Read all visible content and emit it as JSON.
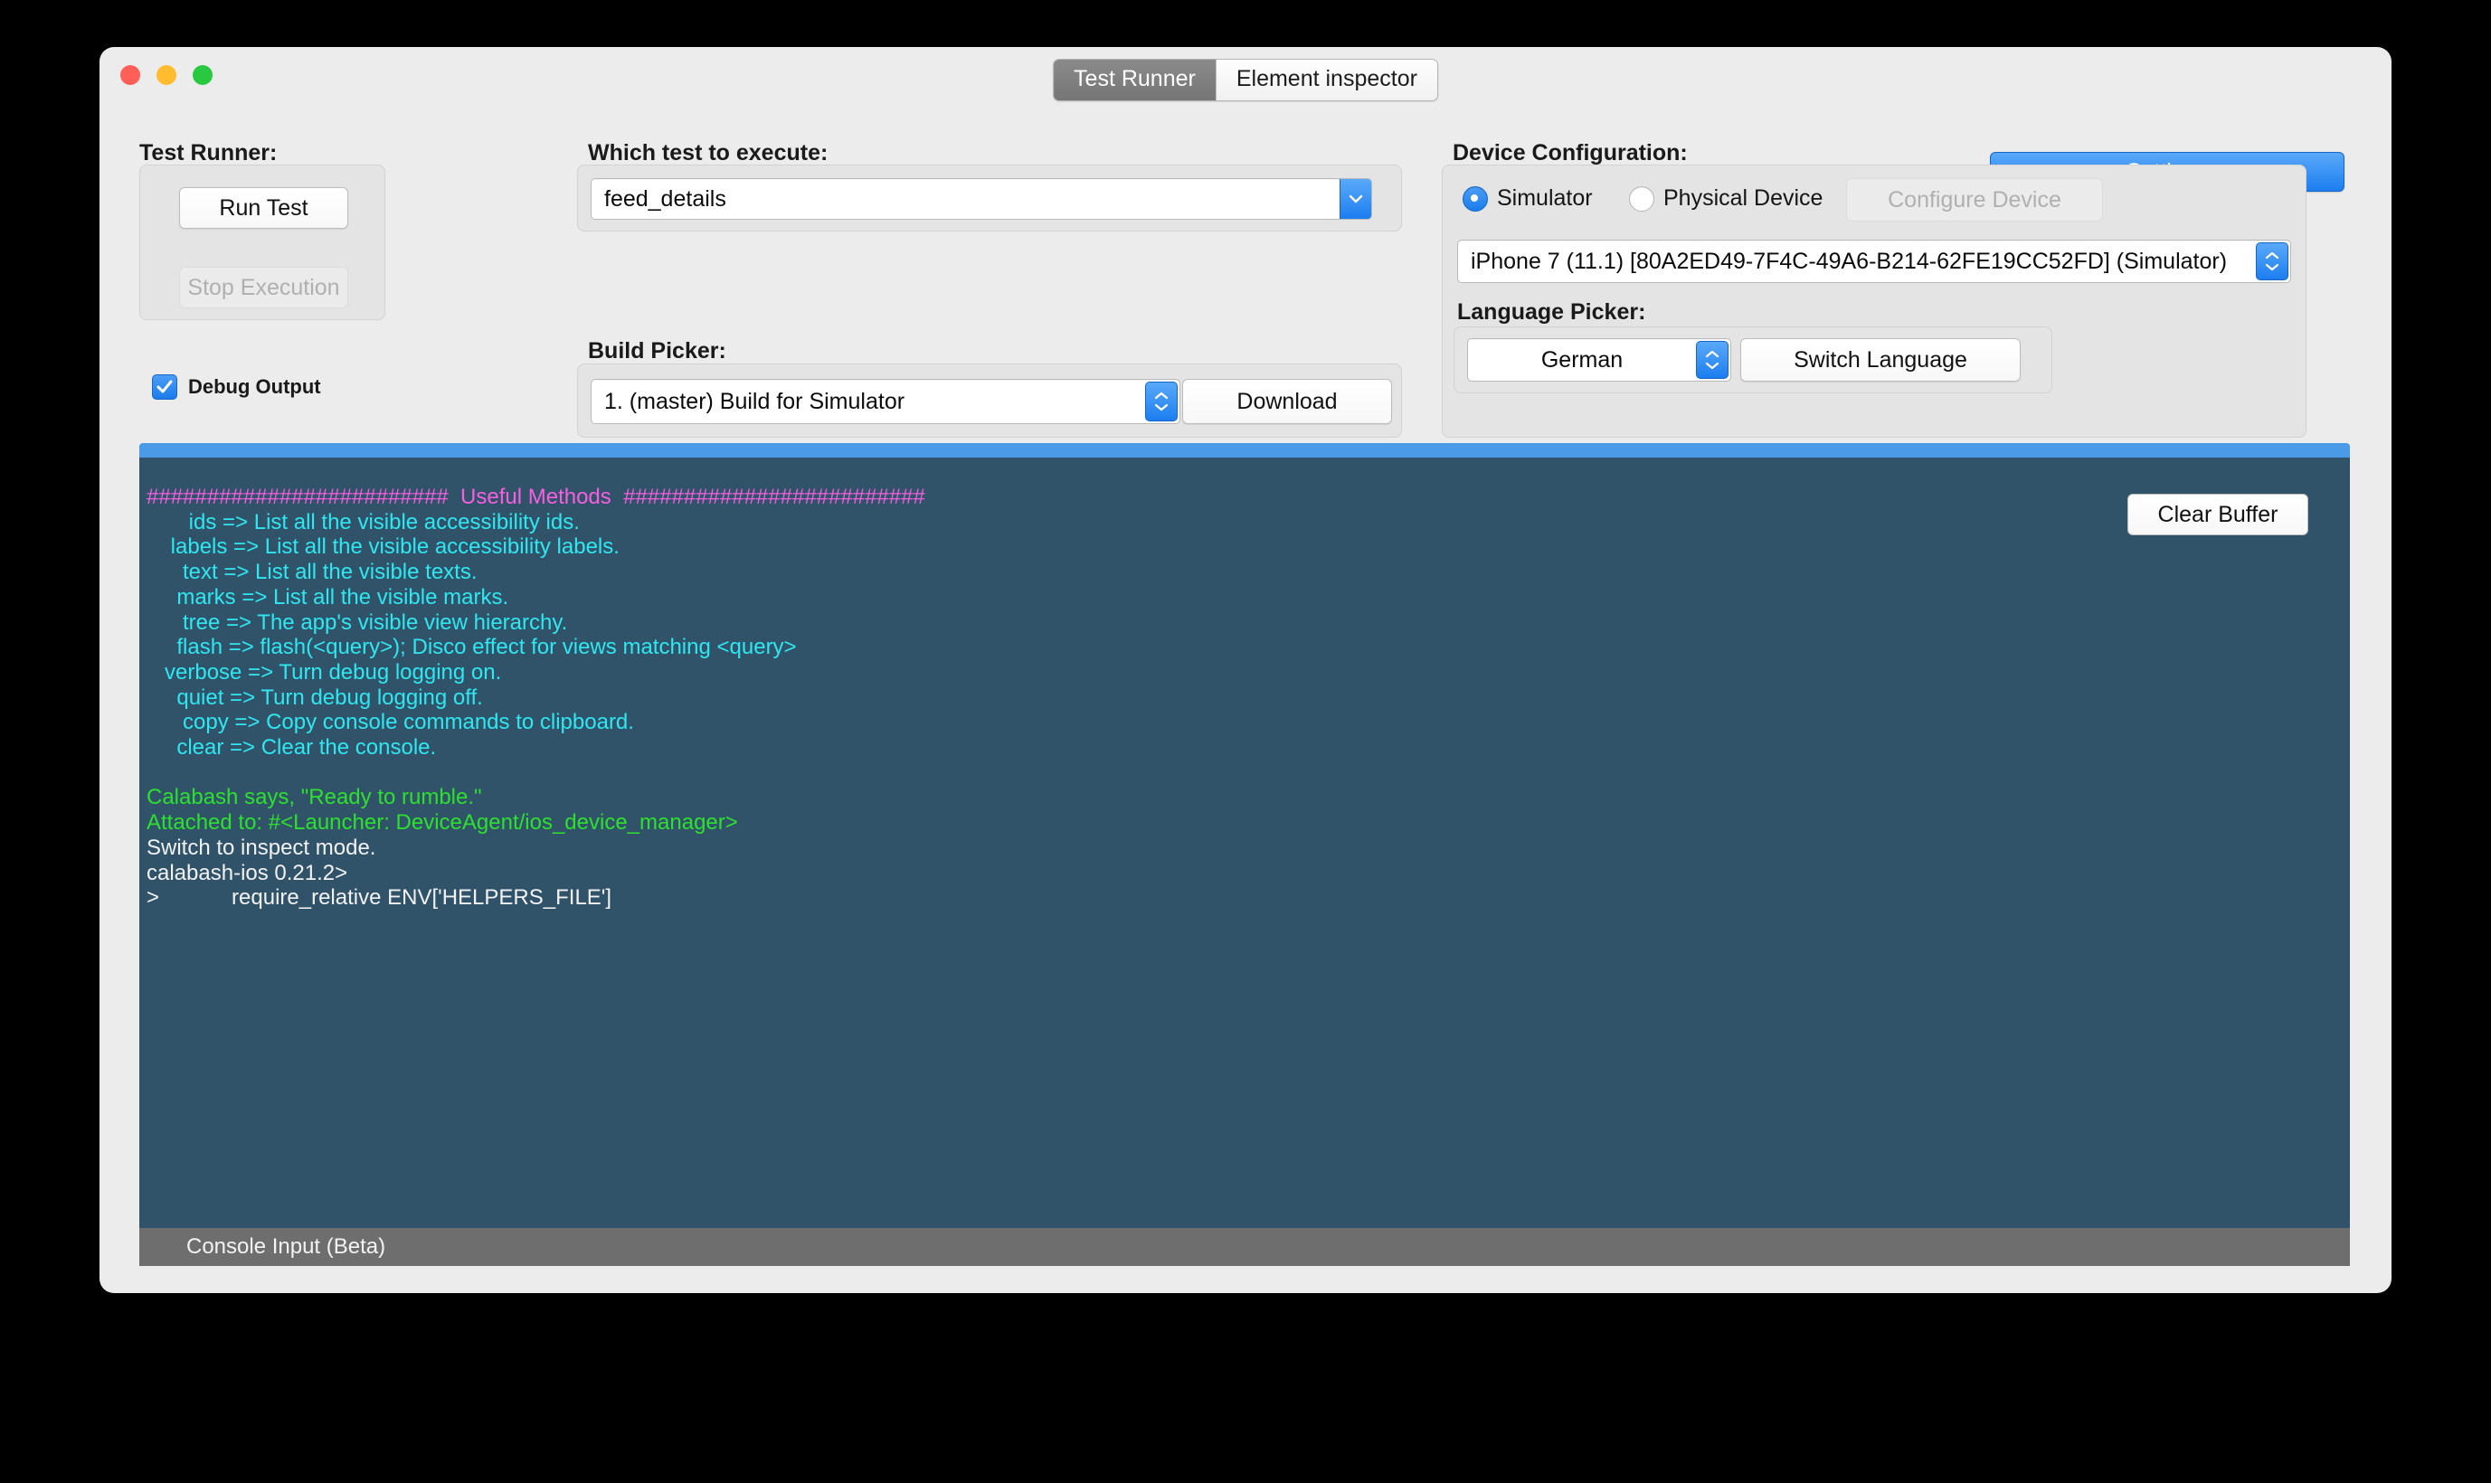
{
  "window": {
    "traffic_lights": [
      "close",
      "minimize",
      "maximize"
    ],
    "tabs": [
      {
        "label": "Test Runner",
        "active": true
      },
      {
        "label": "Element inspector",
        "active": false
      }
    ]
  },
  "toolbar": {
    "settings_label": "Settings"
  },
  "test_runner": {
    "section_label": "Test Runner:",
    "run_test_label": "Run Test",
    "stop_execution_label": "Stop Execution",
    "stop_execution_disabled": true,
    "debug_output_label": "Debug Output",
    "debug_output_checked": true
  },
  "which_test": {
    "section_label": "Which test to execute:",
    "value": "feed_details"
  },
  "build_picker": {
    "section_label": "Build Picker:",
    "value": "1. (master) Build for Simulator",
    "download_label": "Download"
  },
  "device_configuration": {
    "section_label": "Device Configuration:",
    "radios": [
      {
        "label": "Simulator",
        "selected": true
      },
      {
        "label": "Physical Device",
        "selected": false
      }
    ],
    "configure_device_label": "Configure Device",
    "configure_device_disabled": true,
    "device_value": "iPhone 7 (11.1) [80A2ED49-7F4C-49A6-B214-62FE19CC52FD] (Simulator)"
  },
  "language_picker": {
    "section_label": "Language Picker:",
    "value": "German",
    "switch_language_label": "Switch Language"
  },
  "console": {
    "clear_buffer_label": "Clear Buffer",
    "input_bar_label": "Console Input (Beta)",
    "background_color": "#30536a",
    "header_bar_color": "#4a9ae8",
    "lines": [
      {
        "color": "magenta",
        "text": "#########################  Useful Methods  #########################"
      },
      {
        "color": "cyan",
        "text": "       ids => List all the visible accessibility ids."
      },
      {
        "color": "cyan",
        "text": "    labels => List all the visible accessibility labels."
      },
      {
        "color": "cyan",
        "text": "      text => List all the visible texts."
      },
      {
        "color": "cyan",
        "text": "     marks => List all the visible marks."
      },
      {
        "color": "cyan",
        "text": "      tree => The app's visible view hierarchy."
      },
      {
        "color": "cyan",
        "text": "     flash => flash(<query>); Disco effect for views matching <query>"
      },
      {
        "color": "cyan",
        "text": "   verbose => Turn debug logging on."
      },
      {
        "color": "cyan",
        "text": "     quiet => Turn debug logging off."
      },
      {
        "color": "cyan",
        "text": "      copy => Copy console commands to clipboard."
      },
      {
        "color": "cyan",
        "text": "     clear => Clear the console."
      },
      {
        "color": "cyan",
        "text": ""
      },
      {
        "color": "green",
        "text": "Calabash says, \"Ready to rumble.\""
      },
      {
        "color": "green",
        "text": "Attached to: #<Launcher: DeviceAgent/ios_device_manager>"
      },
      {
        "color": "white",
        "text": "Switch to inspect mode."
      },
      {
        "color": "white",
        "text": "calabash-ios 0.21.2>"
      },
      {
        "color": "white",
        "text": ">            require_relative ENV['HELPERS_FILE']"
      }
    ]
  },
  "colors": {
    "accent_blue": "#1d7ef0",
    "window_bg": "#ececec",
    "group_bg": "#e4e4e4",
    "console_bg": "#30536a"
  }
}
